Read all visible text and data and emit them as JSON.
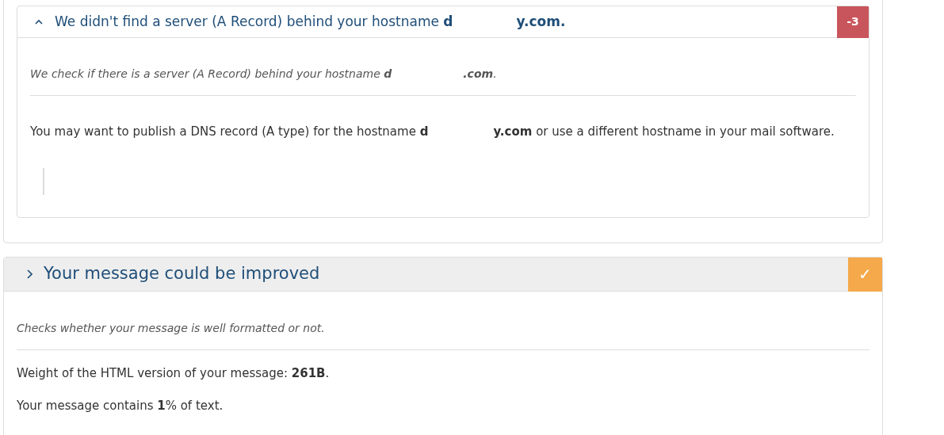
{
  "sections": [
    {
      "title": "We didn't find a server (A Record) behind your hostname ",
      "host_start": "d",
      "host_end": "y.com.",
      "expanded": true,
      "badge": "-3",
      "color": "#c9555c",
      "intro": "We check if there is a server (A Record) behind your hostname ",
      "intro_host_start": "d",
      "intro_host_end": ".com",
      "intro_end": ".",
      "details": [
        {
          "kind": "hostname_advice",
          "before": "You may want to publish a DNS record (A type) for the hostname ",
          "host_start": "d",
          "host_end": "y.com",
          "after": " or use a different hostname in your mail software."
        },
        {
          "kind": "quote"
        }
      ]
    },
    {
      "title": "Your message could be improved",
      "expanded": false,
      "badge": "✓",
      "color": "#f5a94a",
      "intro": "Checks whether your message is well formatted or not.",
      "details": [
        {
          "kind": "text",
          "text": "Weight of the HTML version of your message: **261B**."
        },
        {
          "kind": "text",
          "text": "Your message contains **1**% of text."
        }
      ]
    }
  ]
}
